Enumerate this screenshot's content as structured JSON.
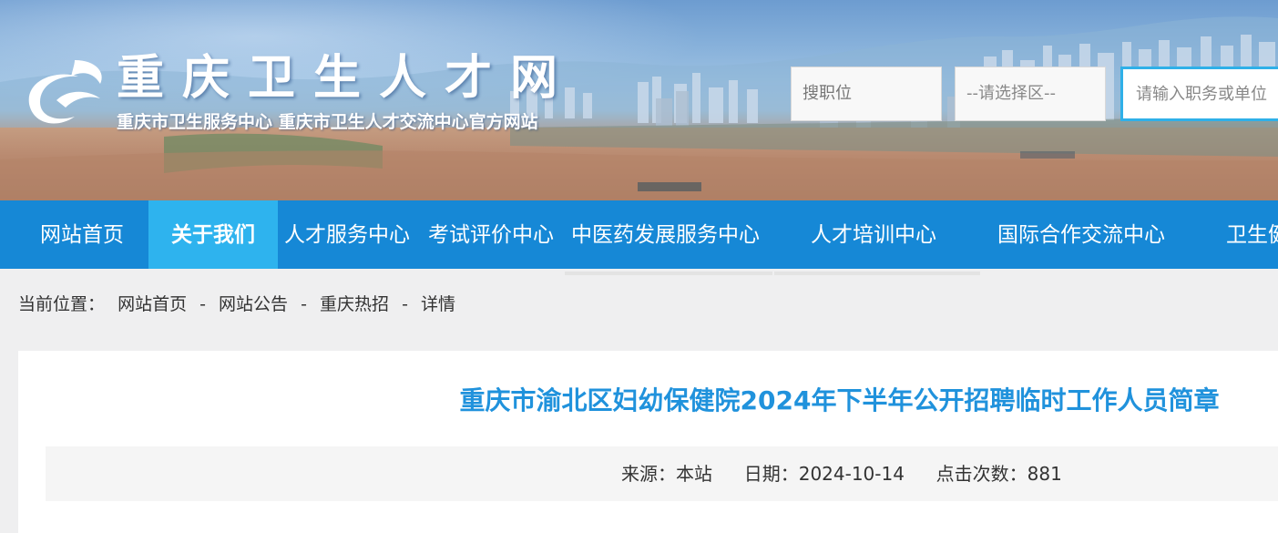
{
  "header": {
    "title": "重庆卫生人才网",
    "subtitle": "重庆市卫生服务中心 重庆市卫生人才交流中心官方网站"
  },
  "search": {
    "position_placeholder": "搜职位",
    "area_placeholder": "--请选择区--",
    "keyword_placeholder": "请输入职务或单位"
  },
  "nav": {
    "items": [
      {
        "label": "网站首页"
      },
      {
        "label": "关于我们",
        "active": true
      },
      {
        "label": "人才服务中心"
      },
      {
        "label": "考试评价中心"
      },
      {
        "label": "中医药发展服务中心"
      },
      {
        "label": "人才培训中心"
      },
      {
        "label": "国际合作交流中心"
      },
      {
        "label": "卫生健"
      }
    ]
  },
  "breadcrumb": {
    "prefix": "当前位置：",
    "items": [
      "网站首页",
      "网站公告",
      "重庆热招",
      "详情"
    ],
    "separator": "-"
  },
  "article": {
    "title": "重庆市渝北区妇幼保健院2024年下半年公开招聘临时工作人员简章",
    "source_label": "来源：",
    "source": "本站",
    "date_label": "日期：",
    "date": "2024-10-14",
    "views_label": "点击次数：",
    "views": "881"
  },
  "colors": {
    "nav_bg": "#1688d6",
    "nav_active": "#2eb3ee",
    "title_blue": "#2092dc",
    "search_focus": "#2fb0e8"
  }
}
